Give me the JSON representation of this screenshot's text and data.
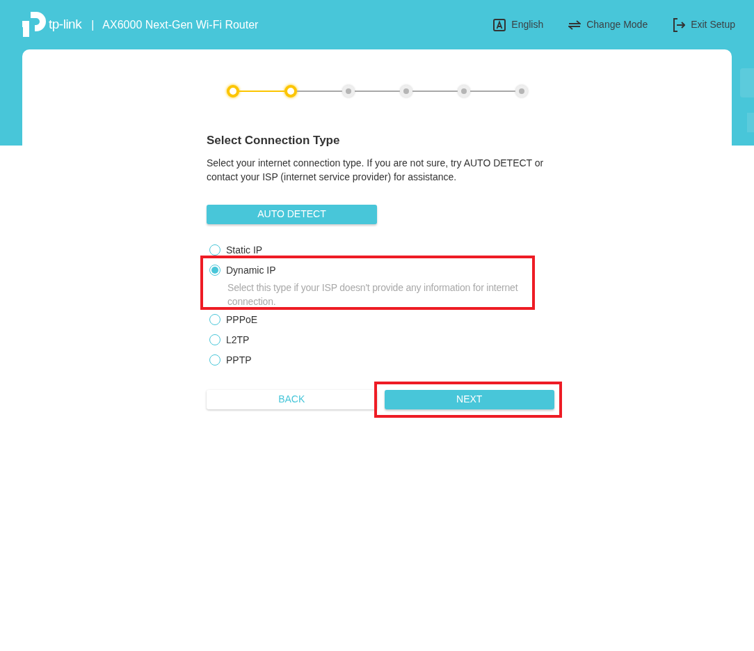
{
  "header": {
    "brand": "tp-link",
    "separator": "|",
    "title": "AX6000 Next-Gen Wi-Fi Router",
    "nav": [
      {
        "kind": "language",
        "label": "English"
      },
      {
        "kind": "mode",
        "label": "Change Mode"
      },
      {
        "kind": "exit",
        "label": "Exit Setup"
      }
    ]
  },
  "steps": [
    {
      "done": true
    },
    {
      "done": true
    },
    {
      "done": false
    },
    {
      "done": false
    },
    {
      "done": false
    },
    {
      "done": false
    }
  ],
  "heading": "Select Connection Type",
  "description": "Select your internet connection type. If you are not sure, try AUTO DETECT or contact your ISP (internet service provider) for assistance.",
  "auto_detect": "AUTO DETECT",
  "options": [
    {
      "label": "Static IP",
      "selected": false
    },
    {
      "label": "Dynamic IP",
      "selected": true,
      "hint": "Select this type if your ISP doesn't provide any information for internet connection."
    },
    {
      "label": "PPPoE",
      "selected": false
    },
    {
      "label": "L2TP",
      "selected": false
    },
    {
      "label": "PPTP",
      "selected": false
    }
  ],
  "buttons": [
    {
      "kind": "secondary",
      "label": "BACK"
    },
    {
      "kind": "primary",
      "label": "NEXT"
    }
  ]
}
